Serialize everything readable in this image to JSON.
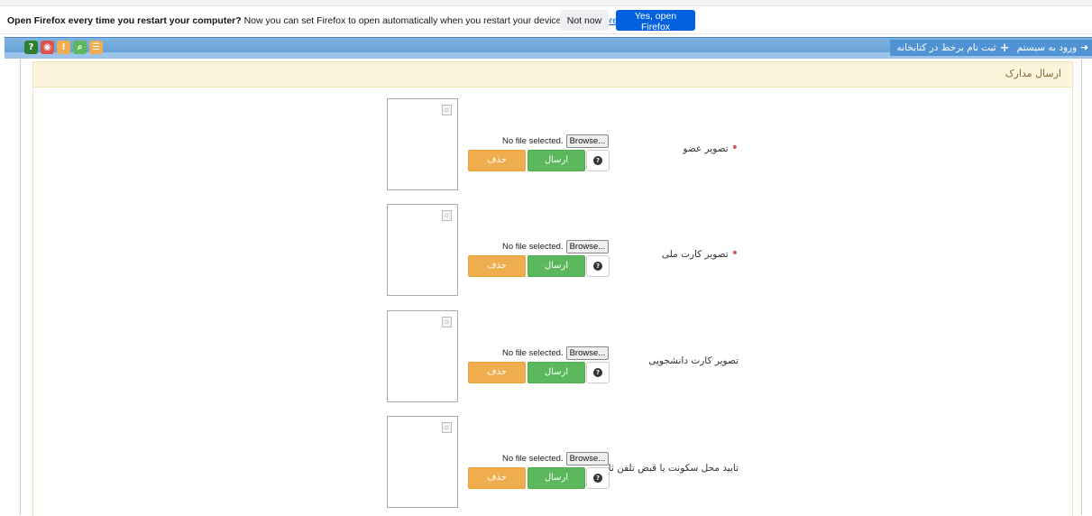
{
  "firefox_bar": {
    "message_bold": "Open Firefox every time you restart your computer?",
    "message": " Now you can set Firefox to open automatically when you restart your device.",
    "learn_more": "Learn more",
    "not_now": "Not now",
    "yes_open": "Yes, open Firefox"
  },
  "navbar": {
    "login": "ورود به سیستم",
    "register": "ثبت نام برخط در کتابخانه",
    "icons": [
      {
        "name": "help-icon",
        "glyph": "?",
        "color": "#2e7d32"
      },
      {
        "name": "globe-icon",
        "glyph": "◉",
        "color": "#d9534f"
      },
      {
        "name": "info-icon",
        "glyph": "!",
        "color": "#f0ad4e"
      },
      {
        "name": "search-icon",
        "glyph": "⌕",
        "color": "#5cb85c"
      },
      {
        "name": "list-icon",
        "glyph": "☰",
        "color": "#f0ad4e"
      }
    ]
  },
  "panel": {
    "title": "ارسال مدارک"
  },
  "documents": [
    {
      "label": "تصویر عضو",
      "required": true,
      "file_status": "No file selected.",
      "browse": "Browse...",
      "send": "ارسال",
      "delete": "حذف"
    },
    {
      "label": "تصویر کارت ملی",
      "required": true,
      "file_status": "No file selected.",
      "browse": "Browse...",
      "send": "ارسال",
      "delete": "حذف"
    },
    {
      "label": "تصویر کارت دانشجویی",
      "required": false,
      "file_status": "No file selected.",
      "browse": "Browse...",
      "send": "ارسال",
      "delete": "حذف"
    },
    {
      "label": "تایید محل سکونت یا قبض تلفن ثابت",
      "required": false,
      "file_status": "No file selected.",
      "browse": "Browse...",
      "send": "ارسال",
      "delete": "حذف"
    }
  ]
}
